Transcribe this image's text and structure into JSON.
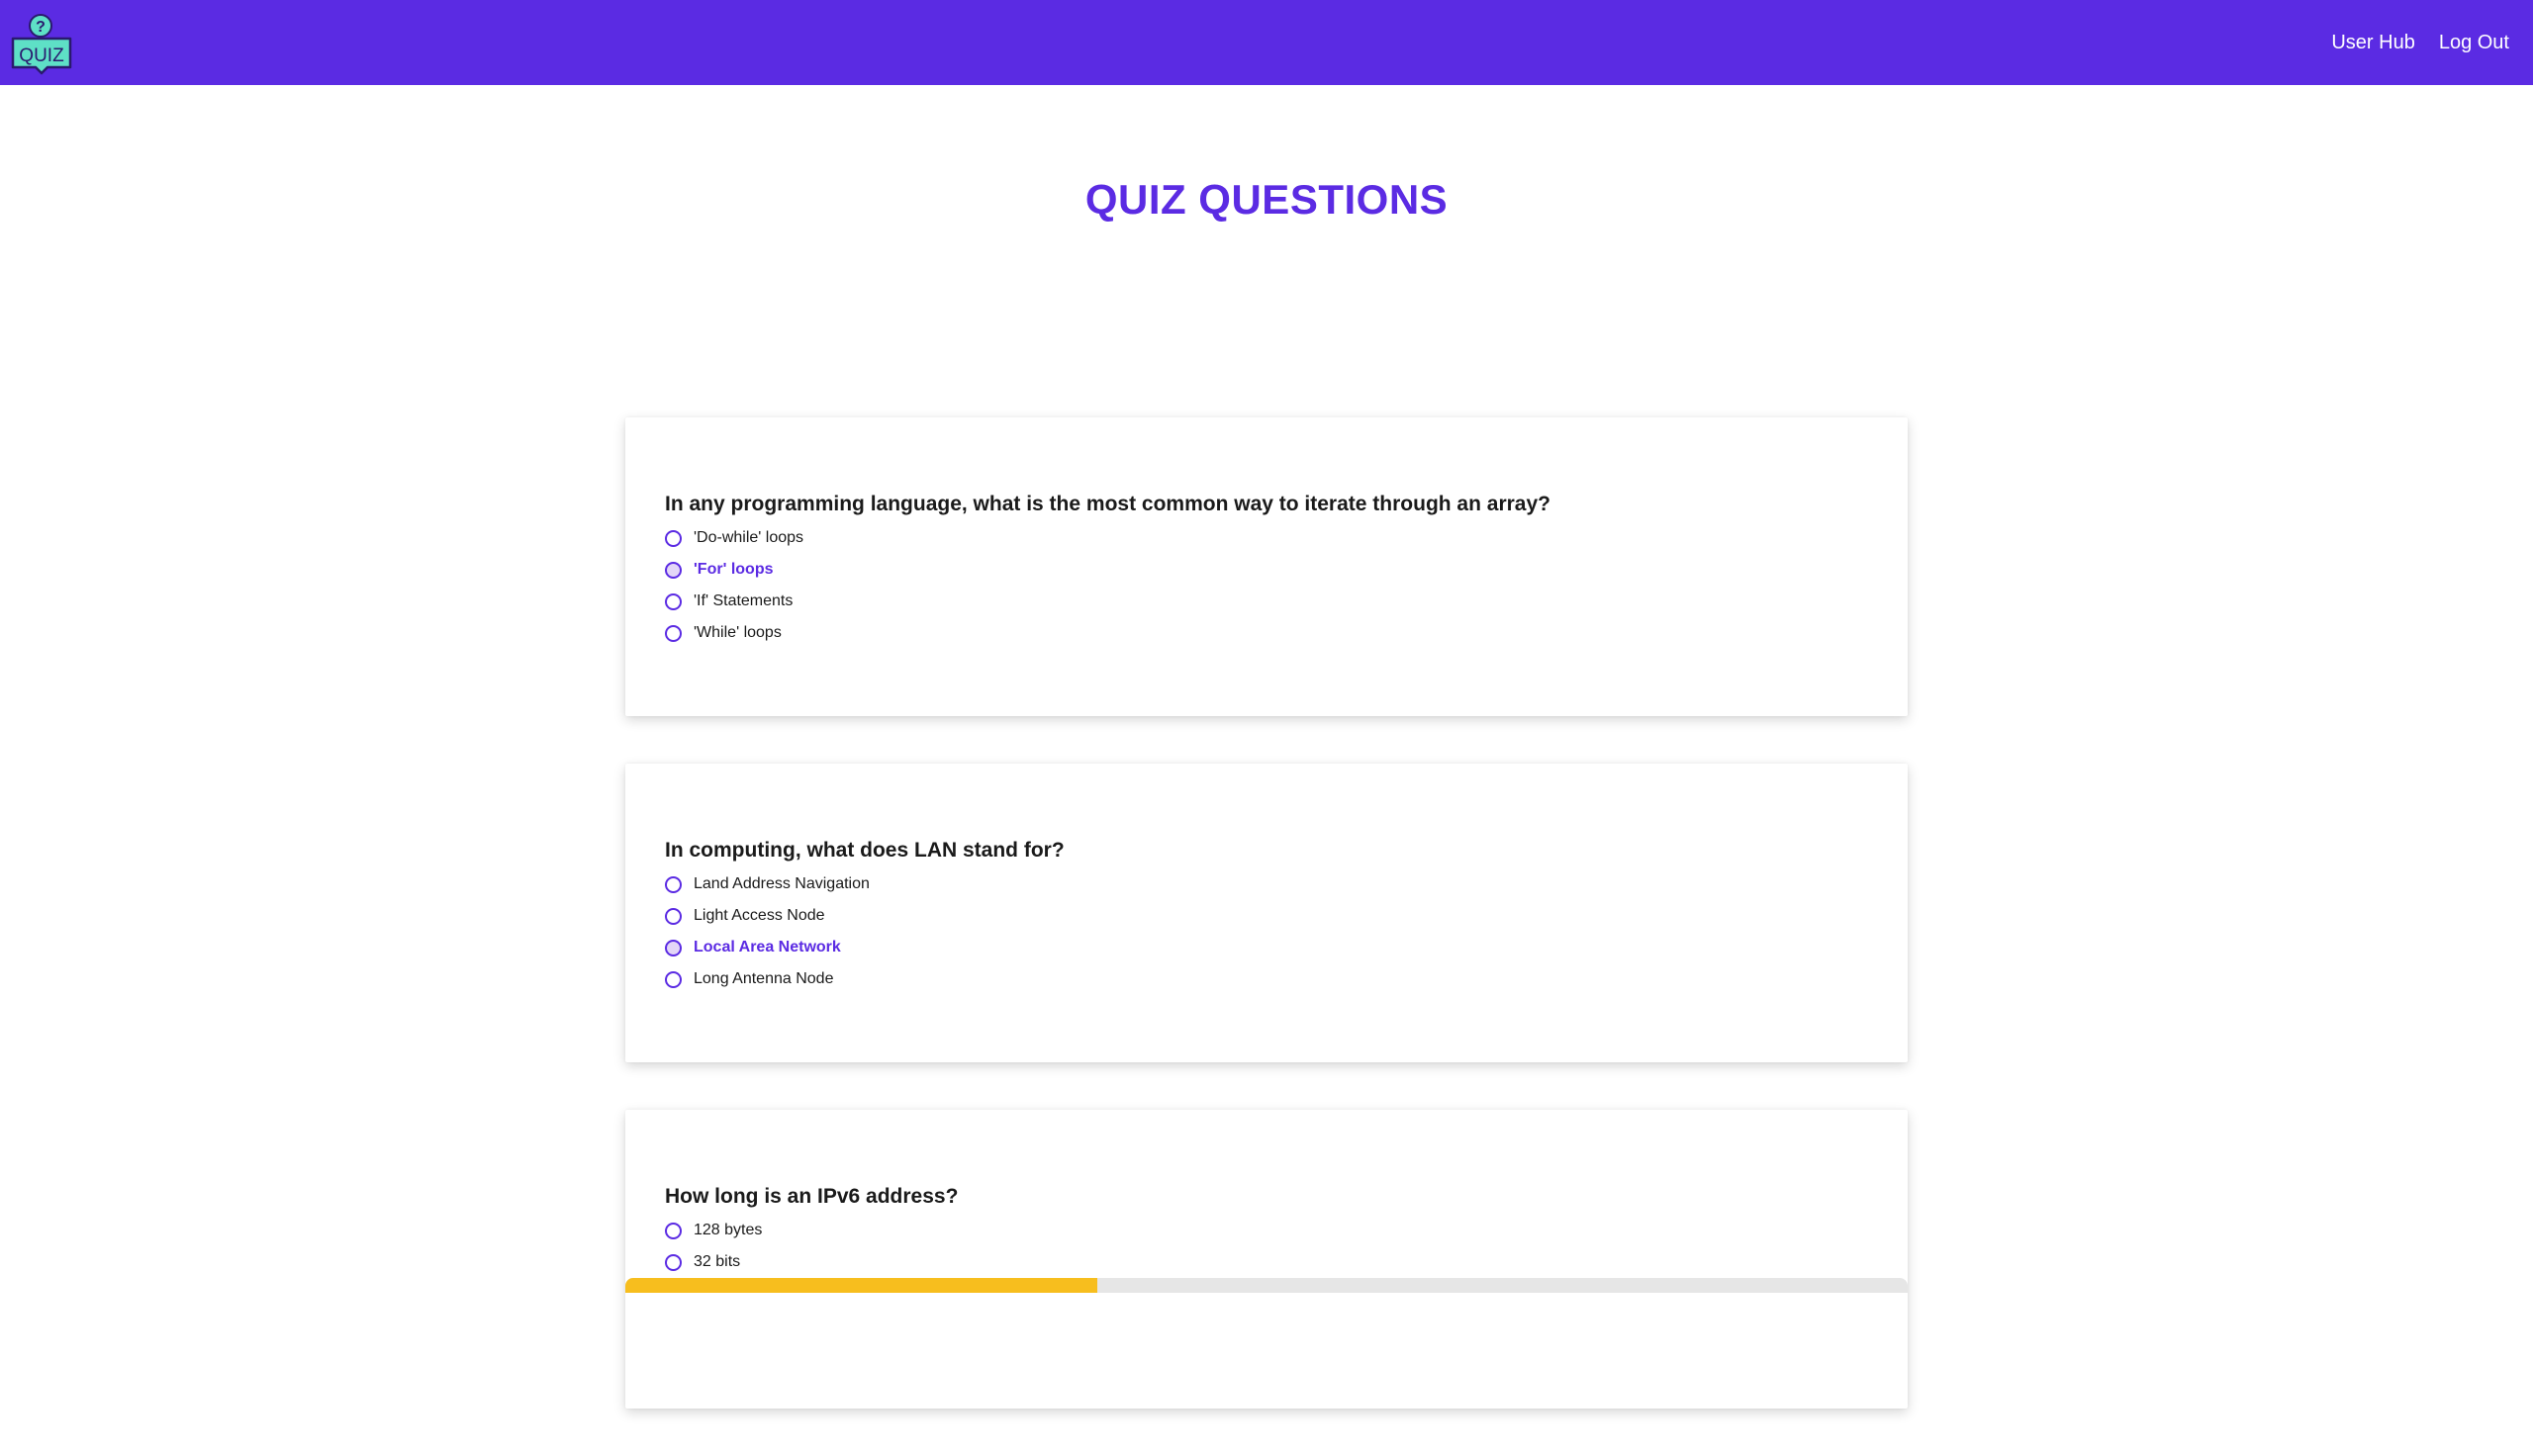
{
  "header": {
    "logo_text": "QUIZ",
    "logo_mark": "?",
    "nav": [
      {
        "label": "User Hub"
      },
      {
        "label": "Log Out"
      }
    ]
  },
  "page": {
    "title": "QUIZ QUESTIONS"
  },
  "questions": [
    {
      "text": "In any programming language, what is the most common way to iterate through an array?",
      "options": [
        "'Do-while' loops",
        "'For' loops",
        "'If' Statements",
        "'While' loops"
      ],
      "selected_index": 1
    },
    {
      "text": "In computing, what does LAN stand for?",
      "options": [
        "Land Address Navigation",
        "Light Access Node",
        "Local Area Network",
        "Long Antenna Node"
      ],
      "selected_index": 2
    },
    {
      "text": "How long is an IPv6 address?",
      "options": [
        "128 bytes",
        "32 bits"
      ],
      "selected_index": null
    }
  ],
  "progress": {
    "fraction": 0.368
  },
  "colors": {
    "brand": "#5b2be3",
    "progress_fill": "#f7be1e",
    "logo_accent": "#5ee0c6"
  }
}
